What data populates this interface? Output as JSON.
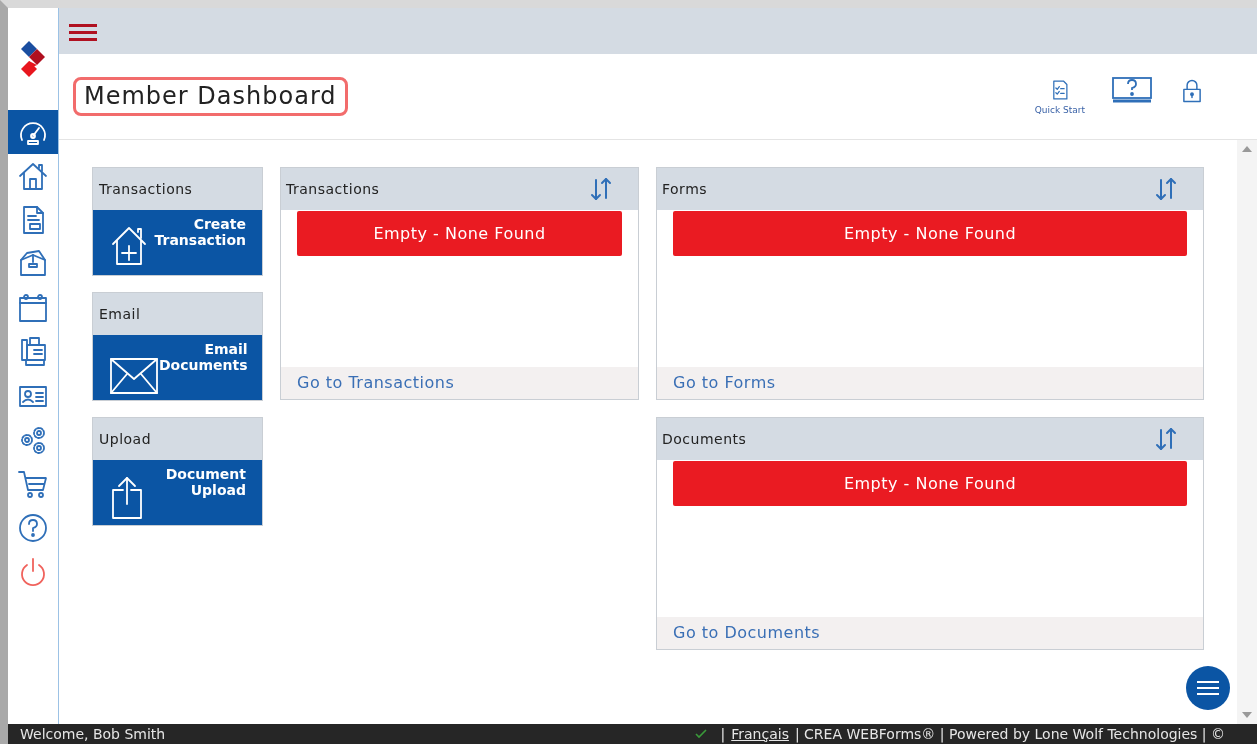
{
  "sidebar": {
    "items": [
      {
        "kind": "dashboard",
        "selected": true
      },
      {
        "kind": "home",
        "selected": false
      },
      {
        "kind": "document",
        "selected": false
      },
      {
        "kind": "box",
        "selected": false
      },
      {
        "kind": "calendar",
        "selected": false
      },
      {
        "kind": "fax",
        "selected": false
      },
      {
        "kind": "contact",
        "selected": false
      },
      {
        "kind": "settings",
        "selected": false
      },
      {
        "kind": "cart",
        "selected": false
      },
      {
        "kind": "help",
        "selected": false
      },
      {
        "kind": "power",
        "selected": false
      }
    ]
  },
  "header": {
    "title": "Member Dashboard",
    "highlighted": true,
    "actions": [
      {
        "kind": "checklist",
        "label": "Quick Start"
      },
      {
        "kind": "monitor-help"
      },
      {
        "kind": "lock"
      }
    ]
  },
  "tiles": [
    {
      "kind": "house-plus",
      "title": "Transactions",
      "action": [
        "Create",
        "Transaction"
      ]
    },
    {
      "kind": "envelope",
      "title": "Email",
      "action": [
        "Email",
        "Documents"
      ]
    },
    {
      "kind": "upload",
      "title": "Upload",
      "action": [
        "Document",
        "Upload"
      ]
    }
  ],
  "panels": [
    {
      "title": "Transactions",
      "empty": "Empty - None Found",
      "link": "Go to Transactions"
    },
    {
      "title": "Forms",
      "empty": "Empty - None Found",
      "link": "Go to Forms"
    },
    {
      "title": "Documents",
      "empty": "Empty - None Found",
      "link": "Go to Documents"
    }
  ],
  "status_bar": {
    "welcome": "Welcome, Bob Smith",
    "separator": "|",
    "language_link": "Français",
    "credits": "| CREA WEBForms® | Powered by Lone Wolf Technologies | ©"
  }
}
